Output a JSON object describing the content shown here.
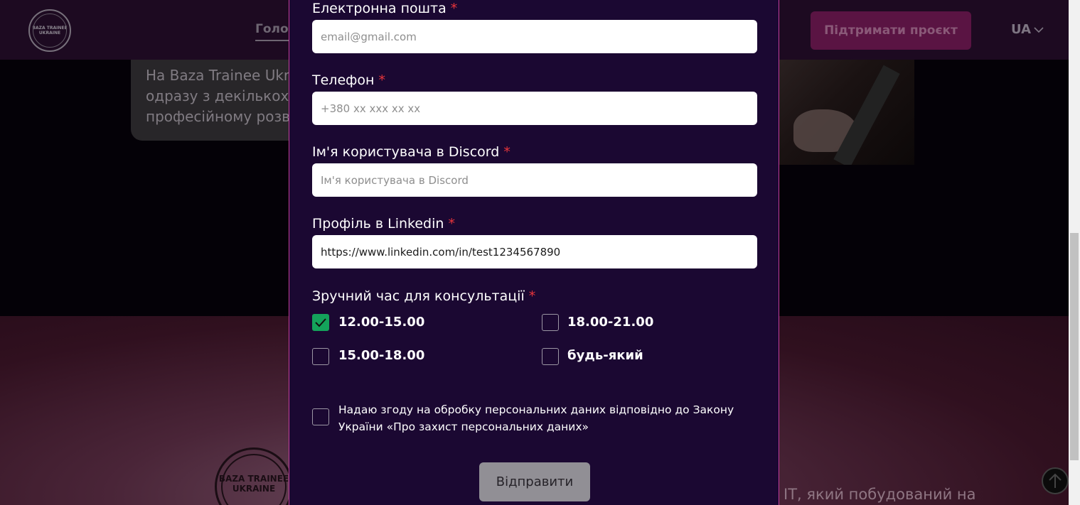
{
  "background": {
    "header": {
      "logo_text": "BAZA TRAINEE UKRAINE",
      "nav_home": "Голо",
      "support_button": "Підтримати проєкт",
      "language": "UA"
    },
    "info_card_lines": [
      "На Baza Trainee Ukr",
      "одразу з декількох",
      "професійному розв"
    ],
    "footer_logo_text": "BAZA TRAINEE UKRAINE",
    "bottom_text": "IT, який побудований на"
  },
  "form": {
    "email": {
      "label": "Електронна пошта",
      "required_mark": "*",
      "placeholder": "email@gmail.com",
      "value": ""
    },
    "phone": {
      "label": "Телефон",
      "required_mark": "*",
      "placeholder": "+380 xx xxx xx xx",
      "value": ""
    },
    "discord": {
      "label": "Ім'я користувача в Discord",
      "required_mark": "*",
      "placeholder": "Ім'я користувача в Discord",
      "value": ""
    },
    "linkedin": {
      "label": "Профіль в Linkedin",
      "required_mark": "*",
      "placeholder": "",
      "value": "https://www.linkedin.com/in/test1234567890"
    },
    "time": {
      "label": "Зручний час для консультації",
      "required_mark": "*",
      "options": [
        {
          "label": "12.00-15.00",
          "checked": true
        },
        {
          "label": "18.00-21.00",
          "checked": false
        },
        {
          "label": "15.00-18.00",
          "checked": false
        },
        {
          "label": "будь-який",
          "checked": false
        }
      ]
    },
    "consent": {
      "text": "Надаю згоду на обробку персональних даних відповідно до Закону України «Про захист персональних даних»",
      "checked": false
    },
    "submit_label": "Відправити"
  },
  "colors": {
    "modal_bg": "#1b0832",
    "modal_border": "#c23e9d",
    "required": "#e8353b",
    "checked": "#14a35b",
    "submit_disabled": "#918f95"
  }
}
